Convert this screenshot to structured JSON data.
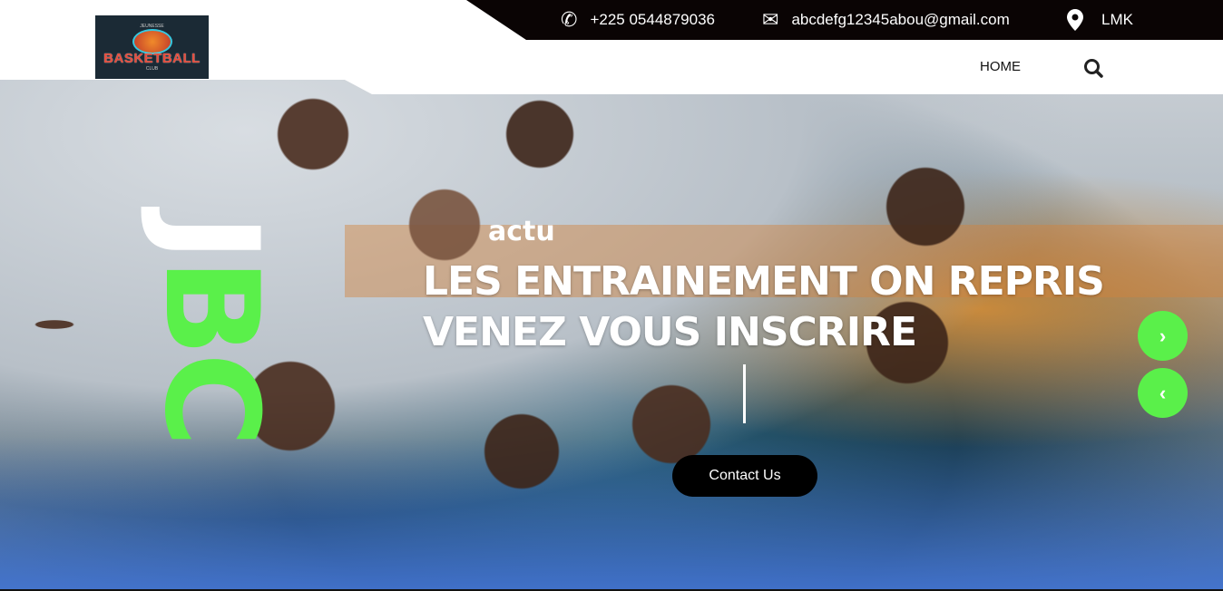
{
  "topbar": {
    "phone": "+225 0544879036",
    "email": "abcdefg12345abou@gmail.com",
    "location": "LMK"
  },
  "logo": {
    "text": "BASKETBALL",
    "top_text": "JEUNESSE",
    "sub_text": "CLUB"
  },
  "nav": {
    "home": "HOME"
  },
  "hero": {
    "vertical_j": "J",
    "vertical_bc": "BC",
    "kicker": "actu",
    "headline_line1": "LES ENTRAINEMENT ON REPRIS",
    "headline_line2": "VENEZ VOUS INSCRIRE",
    "cta": "Contact Us",
    "next": "›",
    "prev": "‹"
  },
  "colors": {
    "accent": "#5af04a",
    "topbar": "#0a0404"
  }
}
